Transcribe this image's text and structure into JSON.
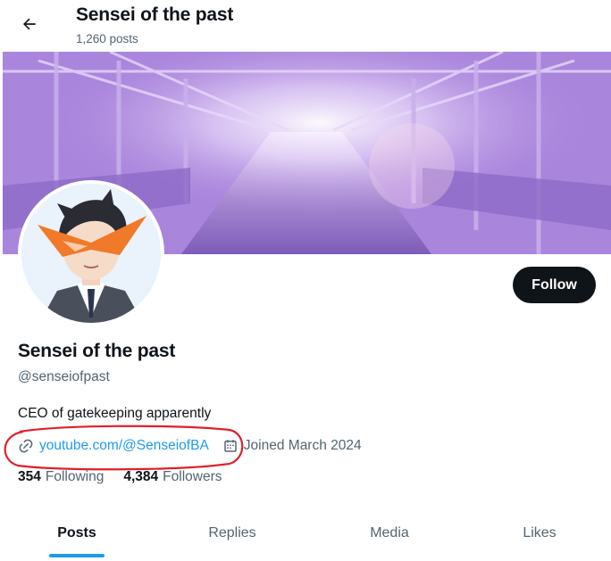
{
  "header": {
    "title": "Sensei of the past",
    "post_count": "1,260 posts",
    "back_icon": "arrow-left-icon"
  },
  "profile": {
    "display_name": "Sensei of the past",
    "handle": "@senseiofpast",
    "bio": "CEO of gatekeeping apparently",
    "link_text": "youtube.com/@SenseiofBA",
    "link_icon": "link-icon",
    "joined_text": "Joined March 2024",
    "joined_icon": "calendar-icon",
    "follow_label": "Follow"
  },
  "stats": {
    "following_count": "354",
    "following_label": "Following",
    "followers_count": "4,384",
    "followers_label": "Followers"
  },
  "tabs": [
    {
      "label": "Posts",
      "active": true
    },
    {
      "label": "Replies",
      "active": false
    },
    {
      "label": "Media",
      "active": false
    },
    {
      "label": "Likes",
      "active": false
    }
  ],
  "colors": {
    "accent": "#1d9bf0",
    "text_primary": "#0f1419",
    "text_secondary": "#536471",
    "annotation": "#e0202a"
  }
}
